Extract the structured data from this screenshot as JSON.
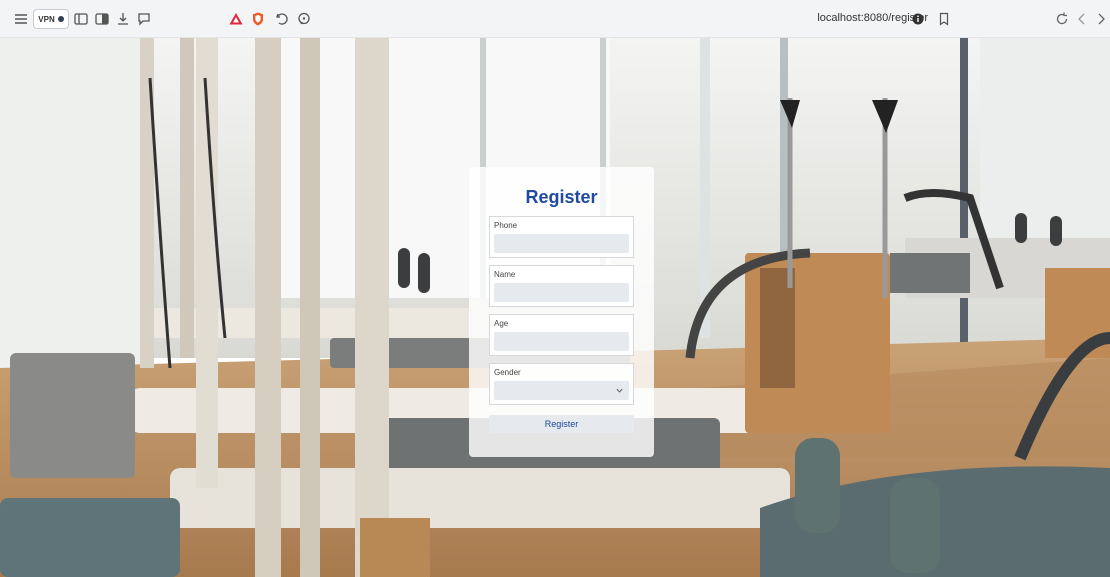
{
  "browser": {
    "vpn_label": "VPN",
    "url": "localhost:8080/register",
    "icons": [
      "menu-icon",
      "vpn-status-icon",
      "sidebar-icon",
      "split-view-icon",
      "download-icon",
      "chat-icon",
      "brave-rewards-icon",
      "brave-shields-icon",
      "history-icon",
      "leo-ai-icon",
      "site-info-icon",
      "bookmark-icon",
      "reload-icon",
      "back-icon",
      "forward-icon"
    ]
  },
  "form": {
    "title": "Register",
    "fields": [
      {
        "label": "Phone",
        "value": ""
      },
      {
        "label": "Name",
        "value": ""
      },
      {
        "label": "Age",
        "value": ""
      },
      {
        "label": "Gender",
        "value": ""
      }
    ],
    "submit_label": "Register"
  },
  "colors": {
    "accent": "#1f4aa0",
    "input_bg": "#e6e9ee"
  }
}
